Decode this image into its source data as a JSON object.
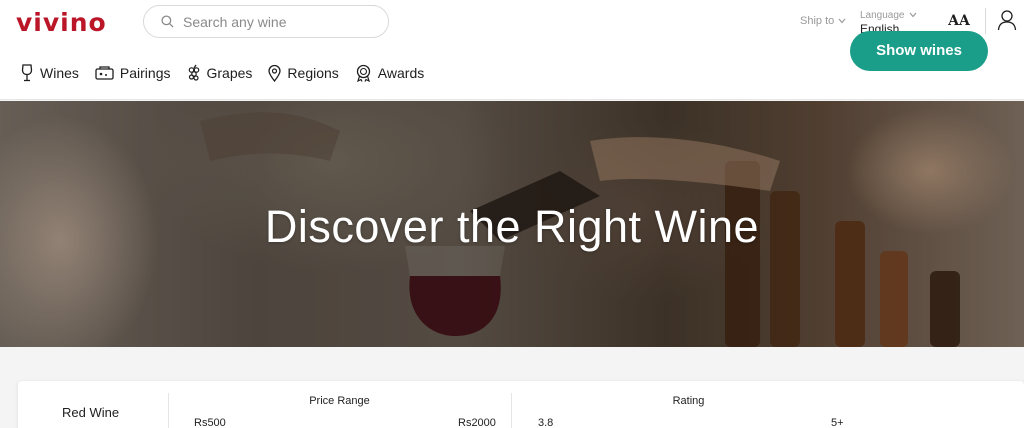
{
  "header": {
    "logo": "vivino",
    "search": {
      "placeholder": "Search any wine"
    },
    "ship_to_label": "Ship to",
    "language": {
      "label": "Language",
      "value": "English"
    },
    "text_size_label": "AA",
    "icons": [
      "search-icon",
      "chevron-down-icon",
      "user-icon"
    ]
  },
  "nav": {
    "items": [
      {
        "label": "Wines",
        "icon": "wine-glass-icon"
      },
      {
        "label": "Pairings",
        "icon": "pairings-icon"
      },
      {
        "label": "Grapes",
        "icon": "grapes-icon"
      },
      {
        "label": "Regions",
        "icon": "map-pin-icon"
      },
      {
        "label": "Awards",
        "icon": "award-icon"
      }
    ]
  },
  "hero": {
    "title": "Discover the Right Wine"
  },
  "filter": {
    "wine_type": "Red Wine",
    "price": {
      "label": "Price Range",
      "min": "Rs500",
      "max": "Rs2000"
    },
    "rating": {
      "label": "Rating",
      "min": "3.8",
      "max": "5+"
    },
    "button": "Show wines"
  },
  "colors": {
    "brand": "#ba1628",
    "accent": "#1a9d89"
  }
}
